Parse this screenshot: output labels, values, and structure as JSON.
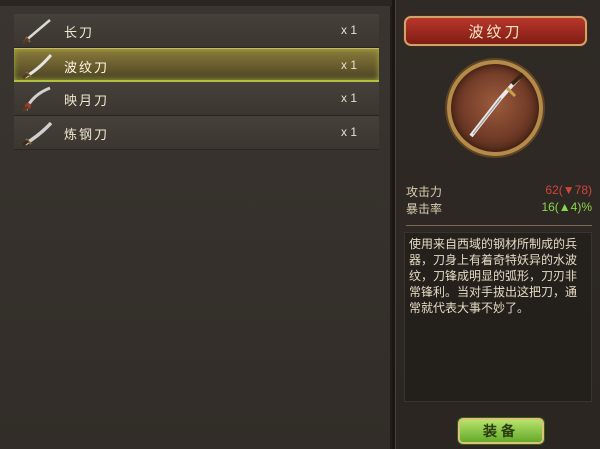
{
  "items": [
    {
      "name": "长刀",
      "qty": "x 1",
      "selected": false
    },
    {
      "name": "波纹刀",
      "qty": "x 1",
      "selected": true
    },
    {
      "name": "映月刀",
      "qty": "x 1",
      "selected": false
    },
    {
      "name": "炼钢刀",
      "qty": "x 1",
      "selected": false
    }
  ],
  "detail": {
    "title": "波纹刀",
    "stats": [
      {
        "label": "攻击力",
        "value": "62(▼78)",
        "color": "#d0443b"
      },
      {
        "label": "暴击率",
        "value": "16(▲4)%",
        "color": "#8ad64a"
      }
    ],
    "description": "使用来自西域的钢材所制成的兵器，刀身上有着奇特妖异的水波纹，刀锋成明显的弧形，刀刃非常锋利。当对手拔出这把刀，通常就代表大事不妙了。",
    "equip_label": "装备"
  },
  "icons": {
    "item_icon": "sword-icon",
    "portrait_icon": "curved-sabre-icon"
  },
  "colors": {
    "selected_highlight": "#b2c040",
    "title_banner": "#b8362a",
    "equip_button": "#8ccf45"
  }
}
